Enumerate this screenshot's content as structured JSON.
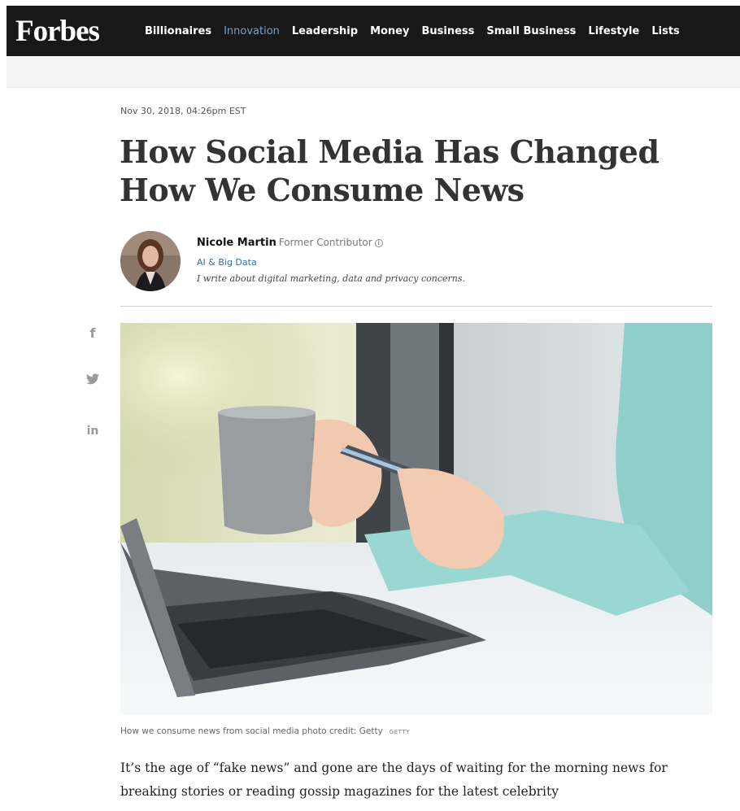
{
  "header": {
    "logo": "Forbes",
    "nav": [
      {
        "label": "Billionaires",
        "active": false
      },
      {
        "label": "Innovation",
        "active": true
      },
      {
        "label": "Leadership",
        "active": false
      },
      {
        "label": "Money",
        "active": false
      },
      {
        "label": "Business",
        "active": false
      },
      {
        "label": "Small Business",
        "active": false
      },
      {
        "label": "Lifestyle",
        "active": false
      },
      {
        "label": "Lists",
        "active": false
      }
    ],
    "accent_color": "#6fa3dc"
  },
  "article": {
    "date": "Nov 30, 2018, 04:26pm EST",
    "title": "How Social Media Has Changed How We Consume News",
    "author": {
      "name": "Nicole Martin",
      "role": "Former Contributor",
      "topic": "AI & Big Data",
      "bio": "I write about digital marketing, data and privacy concerns."
    },
    "share": {
      "facebook": "f",
      "linkedin": "in"
    },
    "caption": "How we consume news from social media photo credit: Getty",
    "caption_credit": "GETTY",
    "body": "It’s the age of “fake news” and gone are the days of waiting for the morning news for breaking stories or reading gossip magazines for the latest celebrity"
  }
}
